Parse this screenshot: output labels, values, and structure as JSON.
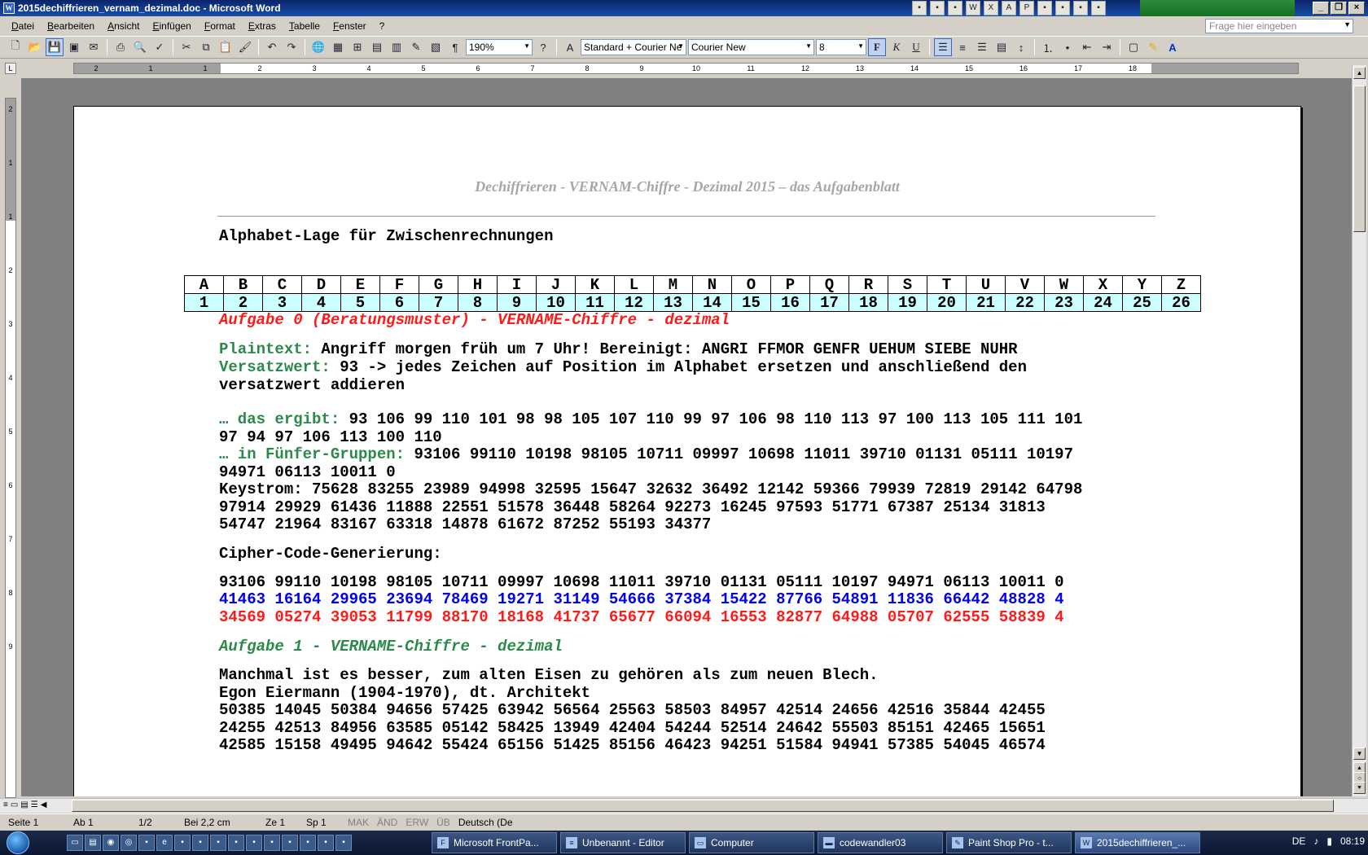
{
  "window": {
    "title": "2015dechiffrieren_vernam_dezimal.doc - Microsoft Word"
  },
  "menu": [
    "Datei",
    "Bearbeiten",
    "Ansicht",
    "Einfügen",
    "Format",
    "Extras",
    "Tabelle",
    "Fenster",
    "?"
  ],
  "help_placeholder": "Frage hier eingeben",
  "toolbar": {
    "zoom": "190%",
    "style": "Standard + Courier Ne",
    "font": "Courier New",
    "size": "8",
    "bold": "F",
    "italic": "K",
    "underline": "U"
  },
  "ruler_labels": [
    "2",
    "1",
    "1",
    "2",
    "3",
    "4",
    "5",
    "6",
    "7",
    "8",
    "9",
    "10",
    "11",
    "12",
    "13",
    "14",
    "15",
    "16",
    "17",
    "18"
  ],
  "vruler_labels": [
    "2",
    "1",
    "1",
    "2",
    "3",
    "4",
    "5",
    "6",
    "7",
    "8",
    "9"
  ],
  "document": {
    "header": "Dechiffrieren - VERNAM-Chiffre - Dezimal 2015 – das Aufgabenblatt",
    "alpha_heading": "Alphabet-Lage für Zwischenrechnungen",
    "letters": [
      "A",
      "B",
      "C",
      "D",
      "E",
      "F",
      "G",
      "H",
      "I",
      "J",
      "K",
      "L",
      "M",
      "N",
      "O",
      "P",
      "Q",
      "R",
      "S",
      "T",
      "U",
      "V",
      "W",
      "X",
      "Y",
      "Z"
    ],
    "numbers": [
      "1",
      "2",
      "3",
      "4",
      "5",
      "6",
      "7",
      "8",
      "9",
      "10",
      "11",
      "12",
      "13",
      "14",
      "15",
      "16",
      "17",
      "18",
      "19",
      "20",
      "21",
      "22",
      "23",
      "24",
      "25",
      "26"
    ],
    "task0_title": "Aufgabe 0 (Beratungsmuster) - VERNAME-Chiffre - dezimal",
    "plaintext_label": "Plaintext:",
    "plaintext": " Angriff morgen früh um 7 Uhr! Bereinigt: ANGRI FFMOR GENFR UEHUM SIEBE NUHR",
    "versatz_label": "Versatzwert:",
    "versatz": " 93 -> jedes Zeichen auf Position im Alphabet ersetzen und anschließend den",
    "versatz2": "versatzwert addieren",
    "ergibt_label": "… das ergibt:",
    "ergibt": " 93 106 99 110 101 98 98 105 107 110 99 97 106 98 110 113 97 100 113 105 111 101",
    "ergibt2": "97 94 97 106 113 100 110",
    "fuenfer_label": "… in Fünfer-Gruppen:",
    "fuenfer": " 93106 99110 10198 98105 10711 09997 10698 11011 39710 01131 05111 10197",
    "fuenfer2": "94971 06113 10011 0",
    "keystrom": "Keystrom: 75628 83255 23989 94998 32595 15647 32632 36492 12142 59366 79939 72819 29142 64798",
    "keystrom2": "97914 29929 61436 11888 22551 51578 36448 58264 92273 16245 97593 51771 67387 25134 31813",
    "keystrom3": "54747 21964 83167 63318 14878 61672 87252 55193 34377",
    "cipher_heading": "Cipher-Code-Generierung:",
    "cipher_black": "93106 99110 10198 98105 10711 09997 10698 11011 39710 01131 05111 10197 94971 06113 10011 0",
    "cipher_blue": "41463 16164 29965 23694 78469 19271 31149 54666 37384 15422 87766 54891 11836 66442 48828 4",
    "cipher_red": "34569 05274 39053 11799 88170 18168 41737 65677 66094 16553 82877 64988 05707 62555 58839 4",
    "task1_title": "Aufgabe 1 - VERNAME-Chiffre - dezimal",
    "quote": "Manchmal ist es besser, zum alten Eisen zu gehören als zum neuen Blech.",
    "author": "Egon Eiermann (1904-1970), dt. Architekt",
    "c1": "50385 14045 50384 94656 57425 63942 56564 25563 58503 84957 42514 24656 42516 35844 42455",
    "c2": "24255 42513 84956 63585 05142 58425 13949 42404 54244 52514 24642 55503 85151 42465 15651",
    "c3": "42585 15158 49495 94642 55424 65156 51425 85156 46423 94251 51584 94941 57385 54045 46574"
  },
  "status": {
    "page": "Seite 1",
    "section": "Ab 1",
    "pages": "1/2",
    "pos": "Bei 2,2 cm",
    "line": "Ze 1",
    "col": "Sp 1",
    "mak": "MAK",
    "aend": "ÄND",
    "erw": "ERW",
    "ueb": "ÜB",
    "lang": "Deutsch (De"
  },
  "taskbar": {
    "tasks": [
      "Microsoft FrontPa...",
      "Unbenannt - Editor",
      "Computer",
      "codewandler03",
      "Paint Shop Pro - t...",
      "2015dechiffrieren_..."
    ],
    "lang": "DE",
    "clock": "08:19"
  }
}
